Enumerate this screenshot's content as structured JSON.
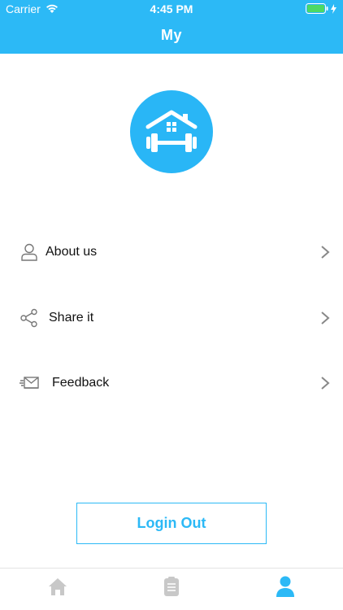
{
  "status_bar": {
    "carrier": "Carrier",
    "time": "4:45 PM"
  },
  "header": {
    "title": "My"
  },
  "logo": {
    "icon": "home-gym-logo-icon"
  },
  "menu": [
    {
      "label": "About us",
      "icon": "person-icon"
    },
    {
      "label": "Share it",
      "icon": "share-icon"
    },
    {
      "label": "Feedback",
      "icon": "envelope-icon"
    }
  ],
  "login_button": {
    "label": "Login Out"
  },
  "tabbar": {
    "tabs": [
      {
        "icon": "home-icon",
        "active": false
      },
      {
        "icon": "clipboard-icon",
        "active": false
      },
      {
        "icon": "profile-icon",
        "active": true
      }
    ]
  },
  "colors": {
    "accent": "#2cb9f6",
    "inactive": "#c8c8c8",
    "battery": "#4cd964"
  }
}
